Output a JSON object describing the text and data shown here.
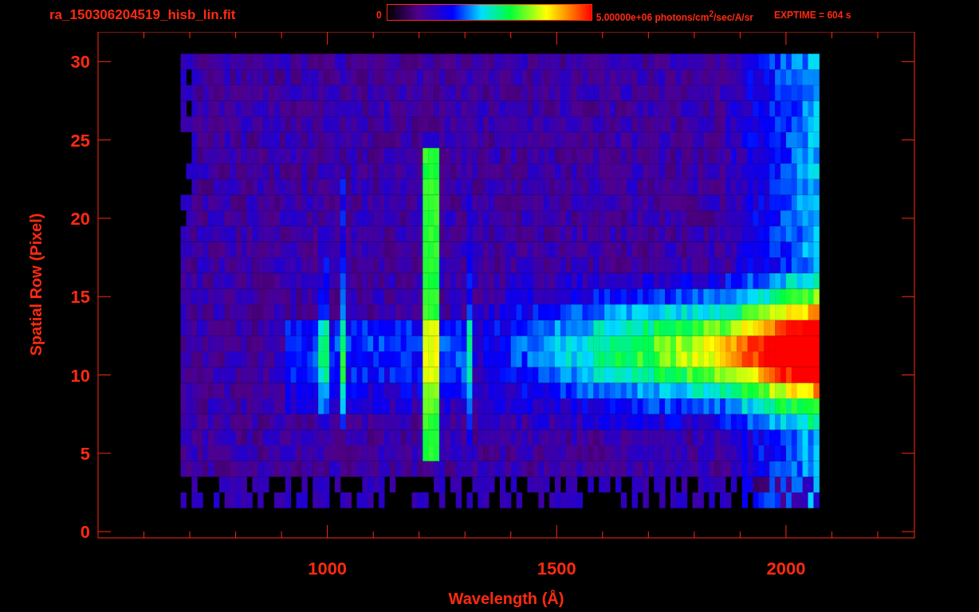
{
  "header": {
    "filename": "ra_150306204519_hisb_lin.fit",
    "colorbar_min": "0",
    "colorbar_max": "5.00000e+06 photons/cm$^{2}$/sec/A/sr",
    "exptime": "EXPTIME = 604 s"
  },
  "plot": {
    "xlabel": "Wavelength (Å)",
    "ylabel": "Spatial Row (Pixel)",
    "xticks": [
      "1000",
      "1500",
      "2000"
    ],
    "yticks": [
      "30",
      "25",
      "20",
      "15",
      "10",
      "5",
      "0"
    ]
  }
}
